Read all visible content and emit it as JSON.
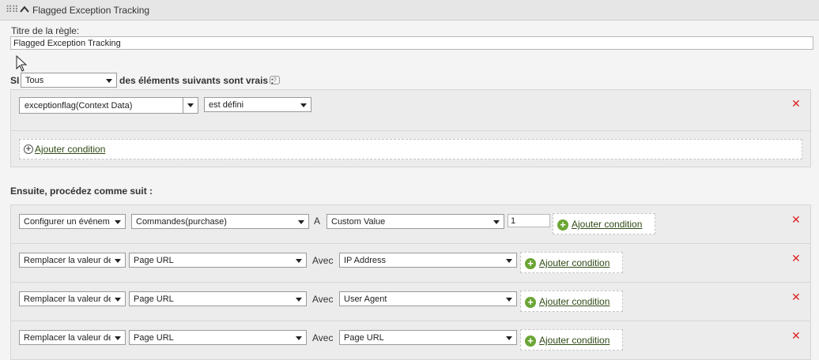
{
  "header": {
    "title": "Flagged Exception Tracking"
  },
  "rule": {
    "title_label": "Titre de la règle:",
    "title_value": "Flagged Exception Tracking"
  },
  "if": {
    "si_label": "SI",
    "mode": "Tous",
    "suffix": "des éléments suivants sont vrais :",
    "condition": {
      "variable": "exceptionflag(Context Data)",
      "operator": "est défini"
    },
    "add_condition": "Ajouter condition"
  },
  "then": {
    "label": "Ensuite, procédez comme suit :",
    "actions": [
      {
        "action": "Configurer un événem",
        "target": "Commandes(purchase)",
        "connector": "A",
        "source": "Custom Value",
        "value": "1",
        "add": "Ajouter condition"
      },
      {
        "action": "Remplacer la valeur de",
        "target": "Page URL",
        "connector": "Avec",
        "source": "IP Address",
        "add": "Ajouter condition"
      },
      {
        "action": "Remplacer la valeur de",
        "target": "Page URL",
        "connector": "Avec",
        "source": "User Agent",
        "add": "Ajouter condition"
      },
      {
        "action": "Remplacer la valeur de",
        "target": "Page URL",
        "connector": "Avec",
        "source": "Page URL",
        "add": "Ajouter condition"
      }
    ]
  },
  "icons": {
    "remove": "✕",
    "help": "?"
  },
  "colors": {
    "remove": "#d22222",
    "add_green": "#6aa534",
    "link": "#2f4a15"
  }
}
